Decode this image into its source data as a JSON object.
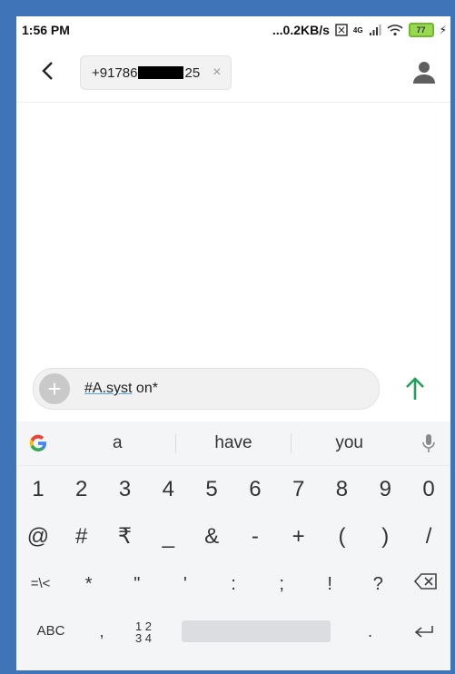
{
  "status": {
    "time": "1:56 PM",
    "net_speed": "...0.2KB/s",
    "signal": "4G",
    "battery": "77"
  },
  "header": {
    "recipient_prefix": "+91786",
    "recipient_suffix": "25",
    "chip_close": "×",
    "back": "<"
  },
  "compose": {
    "plus": "+",
    "text_underlined": "#A.syst",
    "text_rest": " on*"
  },
  "keyboard": {
    "suggestions": [
      "a",
      "have",
      "you"
    ],
    "row1": [
      "1",
      "2",
      "3",
      "4",
      "5",
      "6",
      "7",
      "8",
      "9",
      "0"
    ],
    "row2": [
      "@",
      "#",
      "₹",
      "_",
      "&",
      "-",
      "+",
      "(",
      ")",
      "/"
    ],
    "row3": [
      "=\\<",
      "*",
      "\"",
      "'",
      ":",
      ";",
      "!",
      "?"
    ],
    "row4": {
      "abc": "ABC",
      "comma": ",",
      "numpad_top": "1 2",
      "numpad_bottom": "3 4",
      "period": ".",
      "enter": "⏎"
    }
  },
  "colors": {
    "frame": "#3f74b8",
    "send_arrow": "#21a05a",
    "underline": "#4ea4ff"
  }
}
